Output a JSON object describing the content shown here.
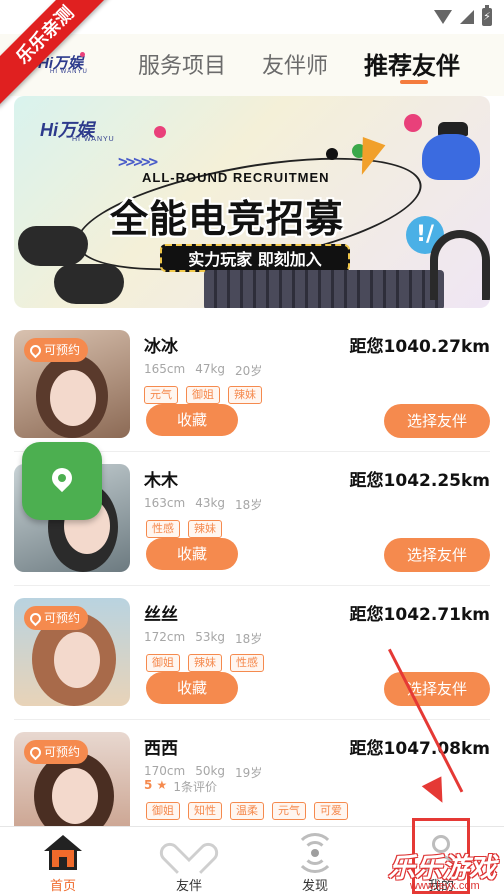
{
  "ribbon": {
    "text": "乐乐亲测"
  },
  "header": {
    "logo_text": "Hi万娱",
    "logo_sub": "HI WANYU",
    "tabs": [
      {
        "label": "服务项目",
        "active": false
      },
      {
        "label": "友伴师",
        "active": false
      },
      {
        "label": "推荐友伴",
        "active": true
      }
    ]
  },
  "banner": {
    "logo_text": "Hi万娱",
    "logo_sub": "HI WANYU",
    "chevrons": ">>>>>",
    "english": "ALL-ROUND RECRUITMEN",
    "title": "全能电竞招募",
    "pill": "实力玩家 即刻加入",
    "bang": "!/"
  },
  "companions": [
    {
      "name": "冰冰",
      "distance": "距您1040.27km",
      "height": "165cm",
      "weight": "47kg",
      "age": "20岁",
      "tags": [
        "元气",
        "御姐",
        "辣妹"
      ],
      "bookable": "可预约",
      "fav_label": "收藏",
      "choose_label": "选择友伴"
    },
    {
      "name": "木木",
      "distance": "距您1042.25km",
      "height": "163cm",
      "weight": "43kg",
      "age": "18岁",
      "tags": [
        "性感",
        "辣妹"
      ],
      "fav_label": "收藏",
      "choose_label": "选择友伴"
    },
    {
      "name": "丝丝",
      "distance": "距您1042.71km",
      "height": "172cm",
      "weight": "53kg",
      "age": "18岁",
      "tags": [
        "御姐",
        "辣妹",
        "性感"
      ],
      "bookable": "可预约",
      "fav_label": "收藏",
      "choose_label": "选择友伴"
    },
    {
      "name": "西西",
      "distance": "距您1047.08km",
      "height": "170cm",
      "weight": "50kg",
      "age": "19岁",
      "rating_score": "5",
      "rating_star": "★",
      "rating_count": "1条评价",
      "tags": [
        "御姐",
        "知性",
        "温柔",
        "元气",
        "可爱"
      ],
      "bookable": "可预约"
    }
  ],
  "bottom_nav": [
    {
      "label": "首页",
      "icon": "home-icon",
      "active": true
    },
    {
      "label": "友伴",
      "icon": "heart-icon",
      "active": false
    },
    {
      "label": "发现",
      "icon": "radar-icon",
      "active": false
    },
    {
      "label": "我的",
      "icon": "user-icon",
      "active": false
    }
  ],
  "watermark": {
    "text": "乐乐游戏",
    "sub": "www.leyx.com"
  },
  "colors": {
    "accent": "#f58a4e",
    "active_nav": "#f06a2b",
    "float_button": "#4caf50",
    "annotation": "#e53935"
  }
}
